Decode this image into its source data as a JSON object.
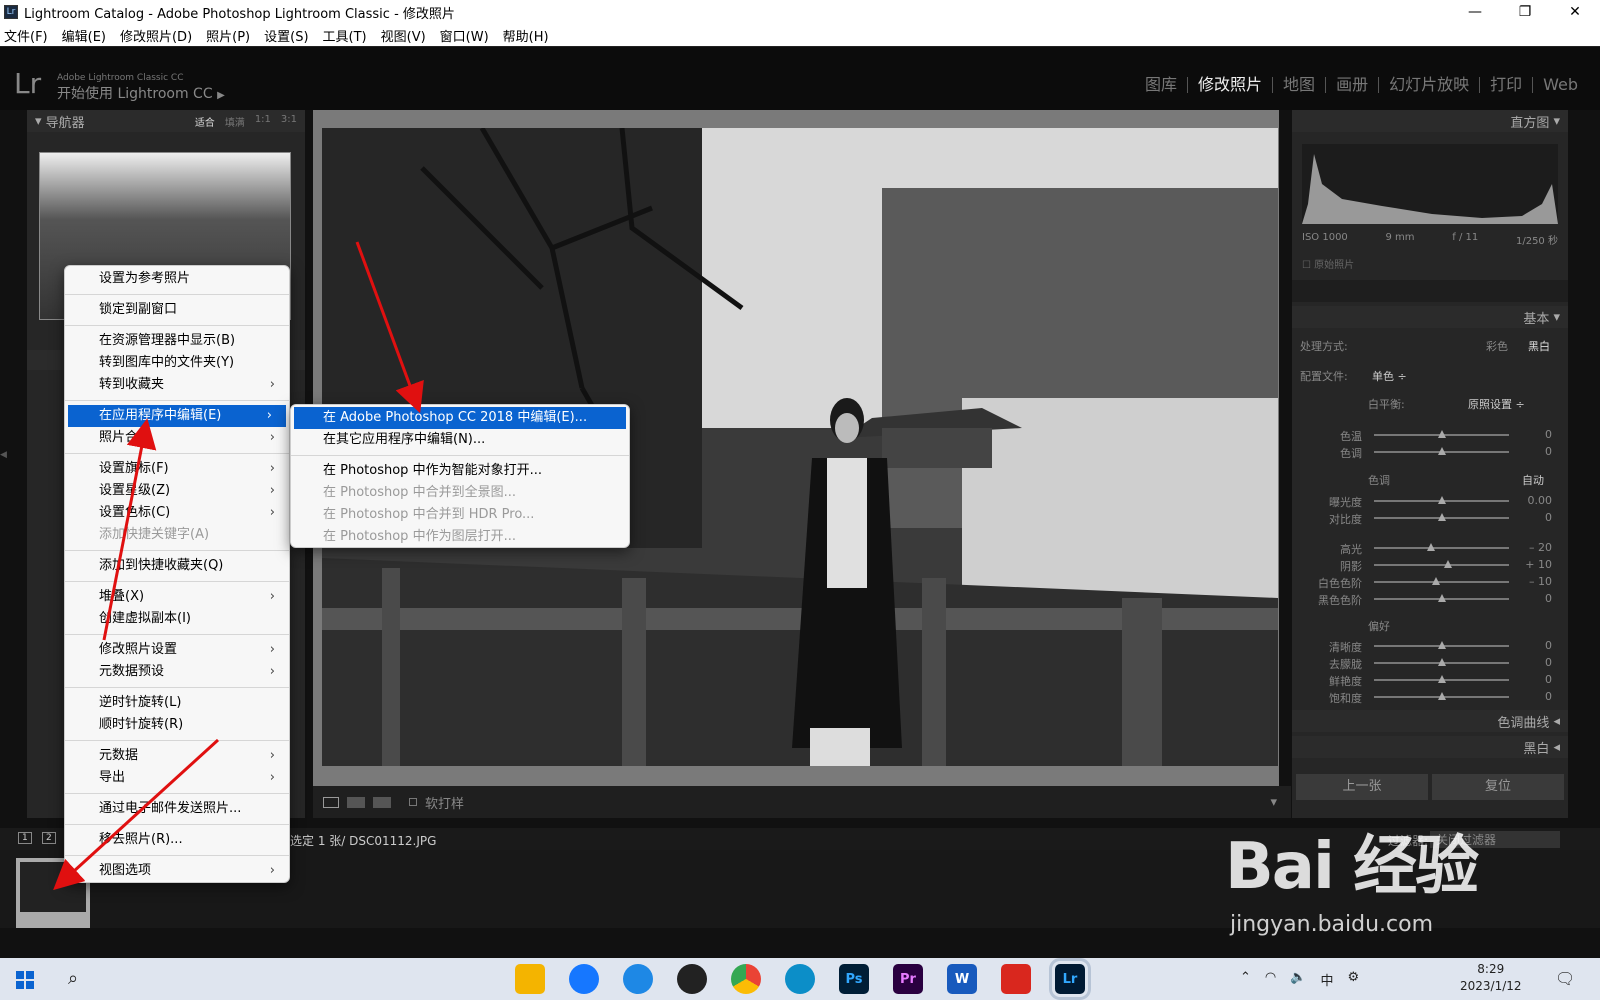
{
  "window": {
    "title": "Lightroom Catalog - Adobe Photoshop Lightroom Classic - 修改照片",
    "icon": "Lr"
  },
  "menubar": [
    "文件(F)",
    "编辑(E)",
    "修改照片(D)",
    "照片(P)",
    "设置(S)",
    "工具(T)",
    "视图(V)",
    "窗口(W)",
    "帮助(H)"
  ],
  "identity": {
    "logo": "Lr",
    "small": "Adobe Lightroom Classic CC",
    "big": "开始使用 Lightroom CC",
    "play": "▶"
  },
  "modules": [
    "图库",
    "修改照片",
    "地图",
    "画册",
    "幻灯片放映",
    "打印",
    "Web"
  ],
  "navigator": {
    "title": "导航器",
    "zoom": [
      "适合",
      "填满",
      "1:1",
      "3:1"
    ]
  },
  "histogram": {
    "title": "直方图",
    "exif": [
      "ISO 1000",
      "9 mm",
      "f / 11",
      "1/250 秒"
    ],
    "original": "原始照片"
  },
  "basic": {
    "title": "基本",
    "treatment_label": "处理方式:",
    "treatment_color": "彩色",
    "treatment_bw": "黑白",
    "profile_label": "配置文件:",
    "profile_value": "单色 ÷",
    "wb_label": "白平衡:",
    "wb_value": "原照设置 ÷",
    "tone_label": "色调",
    "auto": "自动",
    "presence_label": "偏好",
    "sliders": [
      {
        "label": "色温",
        "value": "0"
      },
      {
        "label": "色调",
        "value": "0"
      },
      {
        "label": "曝光度",
        "value": "0.00"
      },
      {
        "label": "对比度",
        "value": "0"
      },
      {
        "label": "高光",
        "value": "– 20"
      },
      {
        "label": "阴影",
        "value": "+ 10"
      },
      {
        "label": "白色色阶",
        "value": "– 10"
      },
      {
        "label": "黑色色阶",
        "value": "0"
      },
      {
        "label": "清晰度",
        "value": "0"
      },
      {
        "label": "去朦胧",
        "value": "0"
      },
      {
        "label": "鲜艳度",
        "value": "0"
      },
      {
        "label": "饱和度",
        "value": "0"
      }
    ]
  },
  "tone_curve": "色调曲线",
  "black_white": "黑白",
  "buttons": {
    "prev": "上一张",
    "reset": "复位"
  },
  "toolbar": {
    "softproof": "软打样"
  },
  "filmstrip": {
    "info": "选定 1 张/ DSC01112.JPG",
    "filter_label": "过滤器:",
    "filter_value": "关闭过滤器",
    "pages": [
      "1",
      "2"
    ]
  },
  "context_menu": [
    {
      "label": "设置为参考照片"
    },
    {
      "sep": true
    },
    {
      "label": "锁定到副窗口"
    },
    {
      "sep": true
    },
    {
      "label": "在资源管理器中显示(B)"
    },
    {
      "label": "转到图库中的文件夹(Y)"
    },
    {
      "label": "转到收藏夹",
      "arrow": true
    },
    {
      "sep": true
    },
    {
      "label": "在应用程序中编辑(E)",
      "arrow": true,
      "hl": true
    },
    {
      "label": "照片合并",
      "arrow": true
    },
    {
      "sep": true
    },
    {
      "label": "设置旗标(F)",
      "arrow": true
    },
    {
      "label": "设置星级(Z)",
      "arrow": true
    },
    {
      "label": "设置色标(C)",
      "arrow": true
    },
    {
      "label": "添加快捷关键字(A)",
      "dis": true
    },
    {
      "sep": true
    },
    {
      "label": "添加到快捷收藏夹(Q)"
    },
    {
      "sep": true
    },
    {
      "label": "堆叠(X)",
      "arrow": true
    },
    {
      "label": "创建虚拟副本(I)"
    },
    {
      "sep": true
    },
    {
      "label": "修改照片设置",
      "arrow": true
    },
    {
      "label": "元数据预设",
      "arrow": true
    },
    {
      "sep": true
    },
    {
      "label": "逆时针旋转(L)"
    },
    {
      "label": "顺时针旋转(R)"
    },
    {
      "sep": true
    },
    {
      "label": "元数据",
      "arrow": true
    },
    {
      "label": "导出",
      "arrow": true
    },
    {
      "sep": true
    },
    {
      "label": "通过电子邮件发送照片..."
    },
    {
      "sep": true
    },
    {
      "label": "移去照片(R)..."
    },
    {
      "sep": true
    },
    {
      "label": "视图选项",
      "arrow": true
    }
  ],
  "submenu": [
    {
      "label": "在 Adobe Photoshop CC 2018 中编辑(E)...",
      "hl": true
    },
    {
      "label": "在其它应用程序中编辑(N)..."
    },
    {
      "sep": true
    },
    {
      "label": "在 Photoshop 中作为智能对象打开..."
    },
    {
      "label": "在 Photoshop 中合并到全景图...",
      "dis": true
    },
    {
      "label": "在 Photoshop 中合并到 HDR Pro...",
      "dis": true
    },
    {
      "label": "在 Photoshop 中作为图层打开...",
      "dis": true
    }
  ],
  "taskbar": {
    "apps": [
      "Ps",
      "Pr",
      "W",
      "Lr"
    ],
    "tray": {
      "ime": "中",
      "time": "8:29",
      "date": "2023/1/12"
    }
  },
  "watermark": {
    "text": "Bai 经验",
    "url": "jingyan.baidu.com"
  },
  "colors": {
    "highlight": "#0a63d0",
    "panel": "#262626",
    "annotation": "#e01010"
  }
}
